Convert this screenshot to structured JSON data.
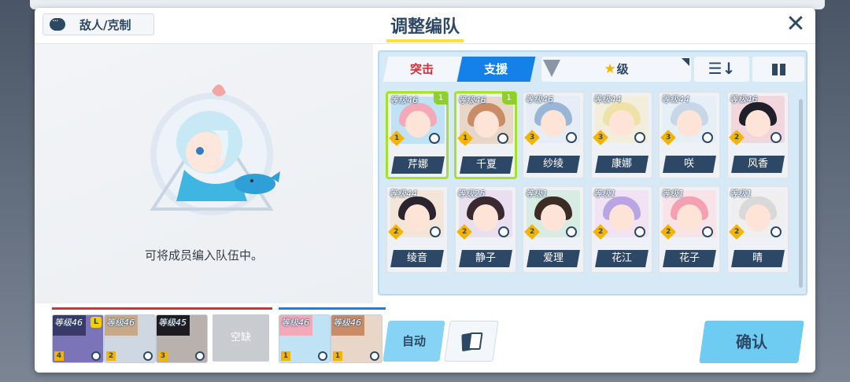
{
  "header": {
    "enemy_button": "敌人/克制",
    "title": "调整编队",
    "close": "✕"
  },
  "left": {
    "hint": "可将成员编入队伍中。"
  },
  "tabs": [
    {
      "label": "突击",
      "active": false
    },
    {
      "label": "支援",
      "active": true
    }
  ],
  "sort": {
    "label": "级",
    "star": "★"
  },
  "order_icon": "☰↓",
  "roster": [
    {
      "level": "等级46",
      "name": "芹娜",
      "stars": "1",
      "badge": "1",
      "selected": true,
      "hair": "#f3a9b8",
      "bg": "#bfe2f5"
    },
    {
      "level": "等级46",
      "name": "千夏",
      "stars": "1",
      "badge": "1",
      "selected": true,
      "hair": "#c98c67",
      "bg": "#e8d6c9"
    },
    {
      "level": "等级46",
      "name": "纱绫",
      "stars": "3",
      "badge": "",
      "selected": false,
      "hair": "#9ab6d6",
      "bg": "#e7edf6"
    },
    {
      "level": "等级44",
      "name": "康娜",
      "stars": "3",
      "badge": "",
      "selected": false,
      "hair": "#efe2a7",
      "bg": "#f2eedb"
    },
    {
      "level": "等级44",
      "name": "咲",
      "stars": "3",
      "badge": "",
      "selected": false,
      "hair": "#c8d7e8",
      "bg": "#e6eef6"
    },
    {
      "level": "等级46",
      "name": "风香",
      "stars": "2",
      "badge": "",
      "selected": false,
      "hair": "#1f1f2a",
      "bg": "#f1d7dc"
    },
    {
      "level": "等级44",
      "name": "绫音",
      "stars": "2",
      "badge": "",
      "selected": false,
      "hair": "#2a2430",
      "bg": "#f3e6d8"
    },
    {
      "level": "等级25",
      "name": "静子",
      "stars": "2",
      "badge": "",
      "selected": false,
      "hair": "#3a2a30",
      "bg": "#e9dfee"
    },
    {
      "level": "等级1",
      "name": "爱理",
      "stars": "2",
      "badge": "",
      "selected": false,
      "hair": "#3b2d26",
      "bg": "#d9ece3"
    },
    {
      "level": "等级1",
      "name": "花江",
      "stars": "2",
      "badge": "",
      "selected": false,
      "hair": "#b9a4e4",
      "bg": "#f1e3f3"
    },
    {
      "level": "等级1",
      "name": "花子",
      "stars": "2",
      "badge": "",
      "selected": false,
      "hair": "#f2a0b2",
      "bg": "#f7e3e8"
    },
    {
      "level": "等级1",
      "name": "晴",
      "stars": "2",
      "badge": "",
      "selected": false,
      "hair": "#d9d9d9",
      "bg": "#efefef"
    }
  ],
  "team": {
    "striker": [
      {
        "level": "等级46",
        "stars": "4",
        "leader": "L",
        "hair": "#3a3a6a",
        "bg": "#7c74b8"
      },
      {
        "level": "等级46",
        "stars": "2",
        "leader": "",
        "hair": "#c7a98a",
        "bg": "#cfd8e2"
      },
      {
        "level": "等级45",
        "stars": "3",
        "leader": "",
        "hair": "#1e1c1e",
        "bg": "#b9b1ae"
      }
    ],
    "empty_label": "空缺",
    "special": [
      {
        "level": "等级46",
        "stars": "1",
        "hair": "#f3a9b8",
        "bg": "#bfe2f5"
      },
      {
        "level": "等级46",
        "stars": "1",
        "hair": "#c98c67",
        "bg": "#e8d6c9"
      }
    ]
  },
  "buttons": {
    "auto": "自动",
    "confirm": "确认"
  },
  "colors": {
    "striker_line": "#d2313a",
    "special_line": "#1381e8",
    "accent": "#1381e8",
    "selected": "#a6e22a"
  }
}
